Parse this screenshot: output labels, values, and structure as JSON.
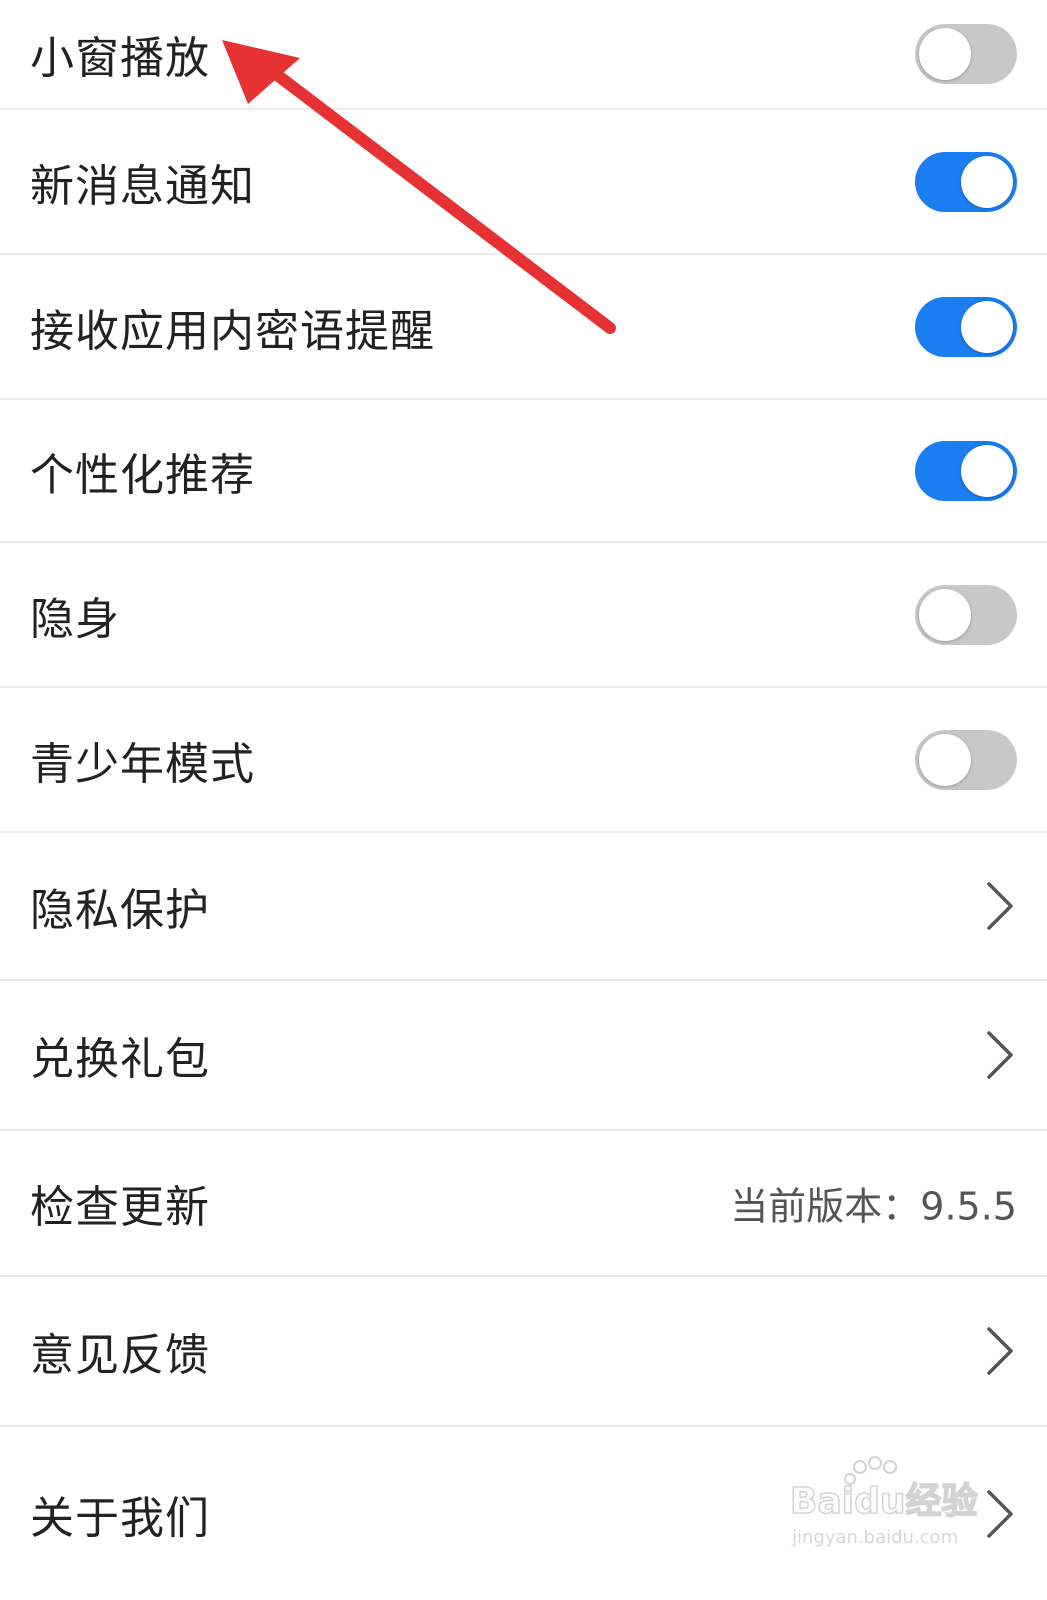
{
  "settings": {
    "items": [
      {
        "label": "小窗播放",
        "control": "toggle",
        "on": false
      },
      {
        "label": "新消息通知",
        "control": "toggle",
        "on": true
      },
      {
        "label": "接收应用内密语提醒",
        "control": "toggle",
        "on": true
      },
      {
        "label": "个性化推荐",
        "control": "toggle",
        "on": true
      },
      {
        "label": "隐身",
        "control": "toggle",
        "on": false
      },
      {
        "label": "青少年模式",
        "control": "toggle",
        "on": false
      },
      {
        "label": "隐私保护",
        "control": "chevron"
      },
      {
        "label": "兑换礼包",
        "control": "chevron"
      },
      {
        "label": "检查更新",
        "control": "value",
        "value": "当前版本：9.5.5"
      },
      {
        "label": "意见反馈",
        "control": "chevron"
      },
      {
        "label": "关于我们",
        "control": "chevron"
      }
    ]
  },
  "colors": {
    "toggle_on": "#1a7ef2",
    "toggle_off": "#c8c8c8",
    "annotation_arrow": "#e63232"
  },
  "watermark": {
    "brand": "Baidu经验",
    "url": "jingyan.baidu.com"
  }
}
